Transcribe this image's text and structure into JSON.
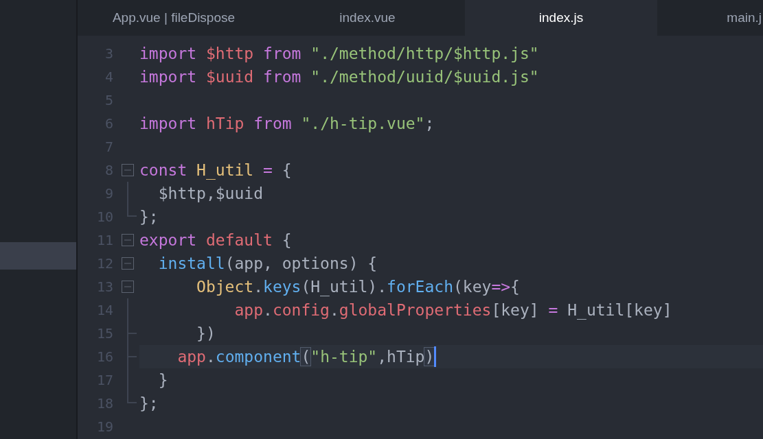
{
  "tabs": [
    {
      "label": "App.vue | fileDispose",
      "selected": false
    },
    {
      "label": "index.vue",
      "selected": false
    },
    {
      "label": "index.js",
      "selected": true
    },
    {
      "label": "main.j",
      "selected": false
    }
  ],
  "sidebar": {
    "items": [
      {
        "selected": true
      }
    ]
  },
  "editor": {
    "lines": [
      {
        "number": "3",
        "tokens": [
          {
            "text": "import ",
            "kind": "keyword"
          },
          {
            "text": "$http ",
            "kind": "variable"
          },
          {
            "text": "from ",
            "kind": "keyword"
          },
          {
            "text": "\"./method/http/$http.js\"",
            "kind": "string"
          }
        ]
      },
      {
        "number": "4",
        "tokens": [
          {
            "text": "import ",
            "kind": "keyword"
          },
          {
            "text": "$uuid ",
            "kind": "variable"
          },
          {
            "text": "from ",
            "kind": "keyword"
          },
          {
            "text": "\"./method/uuid/$uuid.js\"",
            "kind": "string"
          }
        ]
      },
      {
        "number": "5"
      },
      {
        "number": "6",
        "tokens": [
          {
            "text": "import ",
            "kind": "keyword"
          },
          {
            "text": "hTip ",
            "kind": "variable"
          },
          {
            "text": "from ",
            "kind": "keyword"
          },
          {
            "text": "\"./h-tip.vue\"",
            "kind": "string"
          },
          {
            "text": ";",
            "kind": "plain"
          }
        ]
      },
      {
        "number": "7"
      },
      {
        "number": "8",
        "fold": {
          "kind": "open"
        },
        "tokens": [
          {
            "text": "const ",
            "kind": "keyword"
          },
          {
            "text": "H_util ",
            "kind": "class"
          },
          {
            "text": "= ",
            "kind": "operator"
          },
          {
            "text": "{",
            "kind": "plain"
          }
        ]
      },
      {
        "number": "9",
        "fold": {
          "kind": "line"
        },
        "tokens": [
          {
            "text": "  $http,$uuid",
            "kind": "plain"
          }
        ]
      },
      {
        "number": "10",
        "fold": {
          "kind": "end"
        },
        "tokens": [
          {
            "text": "};",
            "kind": "plain"
          }
        ]
      },
      {
        "number": "11",
        "fold": {
          "kind": "open"
        },
        "tokens": [
          {
            "text": "export ",
            "kind": "keyword"
          },
          {
            "text": "default ",
            "kind": "variable"
          },
          {
            "text": "{",
            "kind": "plain"
          }
        ]
      },
      {
        "number": "12",
        "fold": {
          "kind": "open"
        },
        "tokens": [
          {
            "text": "  install",
            "kind": "function"
          },
          {
            "text": "(app, options) {",
            "kind": "plain"
          }
        ]
      },
      {
        "number": "13",
        "fold": {
          "kind": "open"
        },
        "tokens": [
          {
            "text": "      Object",
            "kind": "class"
          },
          {
            "text": ".",
            "kind": "plain"
          },
          {
            "text": "keys",
            "kind": "function"
          },
          {
            "text": "(H_util).",
            "kind": "plain"
          },
          {
            "text": "forEach",
            "kind": "function"
          },
          {
            "text": "(key",
            "kind": "plain"
          },
          {
            "text": "=>",
            "kind": "operator"
          },
          {
            "text": "{",
            "kind": "plain"
          }
        ]
      },
      {
        "number": "14",
        "fold": {
          "kind": "line"
        },
        "tokens": [
          {
            "text": "          app",
            "kind": "variable"
          },
          {
            "text": ".",
            "kind": "plain"
          },
          {
            "text": "config",
            "kind": "variable"
          },
          {
            "text": ".",
            "kind": "plain"
          },
          {
            "text": "globalProperties",
            "kind": "variable"
          },
          {
            "text": "[key] ",
            "kind": "plain"
          },
          {
            "text": "= ",
            "kind": "operator"
          },
          {
            "text": "H_util[key]",
            "kind": "plain"
          }
        ]
      },
      {
        "number": "15",
        "fold": {
          "kind": "branch"
        },
        "tokens": [
          {
            "text": "      })",
            "kind": "plain"
          }
        ]
      },
      {
        "number": "16",
        "fold": {
          "kind": "branch"
        },
        "current": true,
        "tokens": [
          {
            "text": "    app",
            "kind": "variable"
          },
          {
            "text": ".",
            "kind": "plain"
          },
          {
            "text": "component",
            "kind": "function"
          },
          {
            "text": "(",
            "kind": "plain",
            "matched": true
          },
          {
            "text": "\"h-tip\"",
            "kind": "string"
          },
          {
            "text": ",hTip",
            "kind": "plain"
          },
          {
            "text": ")",
            "kind": "plain",
            "matched": true
          }
        ]
      },
      {
        "number": "17",
        "fold": {
          "kind": "line"
        },
        "tokens": [
          {
            "text": "  }",
            "kind": "plain"
          }
        ]
      },
      {
        "number": "18",
        "fold": {
          "kind": "end"
        },
        "tokens": [
          {
            "text": "};",
            "kind": "plain"
          }
        ]
      },
      {
        "number": "19"
      }
    ]
  }
}
